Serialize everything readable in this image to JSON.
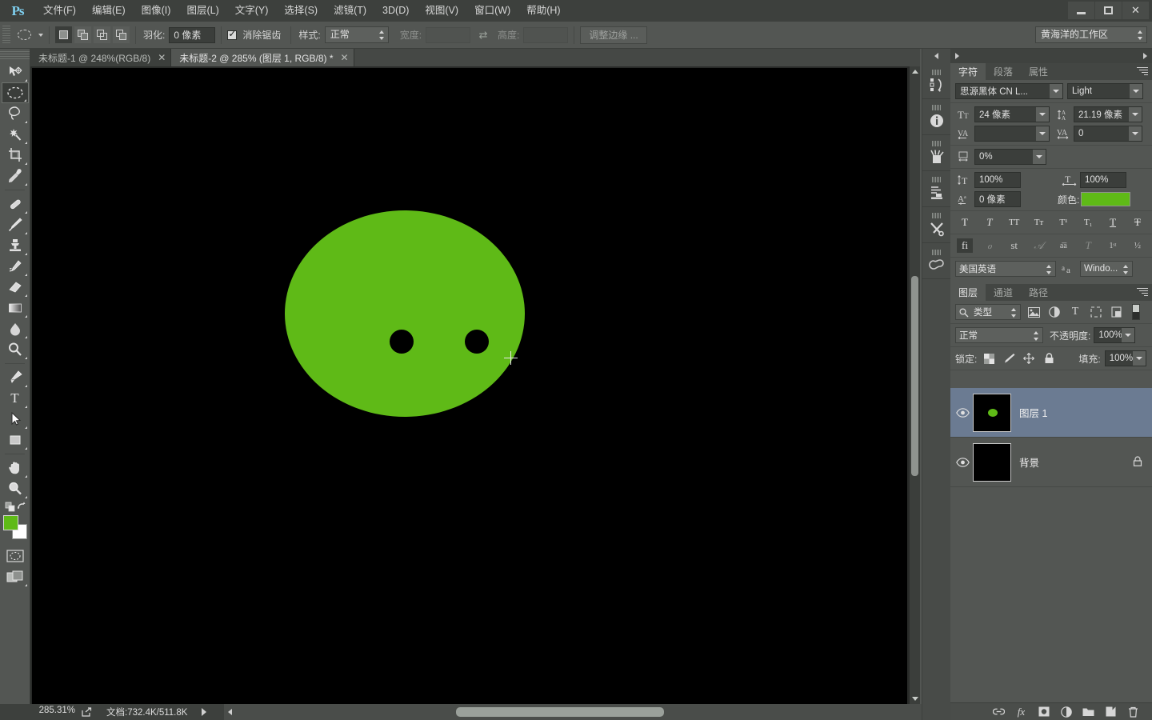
{
  "app": {
    "logo": "Ps",
    "window_controls": {
      "minimize": "minimize-icon",
      "maximize": "maximize-icon",
      "close": "✕"
    }
  },
  "menubar": {
    "items": [
      {
        "label": "文件(F)"
      },
      {
        "label": "编辑(E)"
      },
      {
        "label": "图像(I)"
      },
      {
        "label": "图层(L)"
      },
      {
        "label": "文字(Y)"
      },
      {
        "label": "选择(S)"
      },
      {
        "label": "滤镜(T)"
      },
      {
        "label": "3D(D)"
      },
      {
        "label": "视图(V)"
      },
      {
        "label": "窗口(W)"
      },
      {
        "label": "帮助(H)"
      }
    ]
  },
  "options_bar": {
    "tool": "ellipse-marquee-tool",
    "feather_label": "羽化:",
    "feather_value": "0 像素",
    "antialias_label": "消除锯齿",
    "antialias_checked": true,
    "style_label": "样式:",
    "style_value": "正常",
    "width_label": "宽度:",
    "width_value": "",
    "height_label": "高度:",
    "height_value": "",
    "refine_edge_label": "调整边缘 ...",
    "workspace_value": "黄海洋的工作区"
  },
  "toolbar": {
    "tools": [
      {
        "name": "move-tool",
        "selected": false
      },
      {
        "name": "elliptical-marquee-tool",
        "selected": true
      },
      {
        "name": "lasso-tool",
        "selected": false
      },
      {
        "name": "magic-wand-tool",
        "selected": false
      },
      {
        "name": "crop-tool",
        "selected": false
      },
      {
        "name": "eyedropper-tool",
        "selected": false
      },
      {
        "name": "healing-brush-tool",
        "selected": false
      },
      {
        "name": "brush-tool",
        "selected": false
      },
      {
        "name": "clone-stamp-tool",
        "selected": false
      },
      {
        "name": "history-brush-tool",
        "selected": false
      },
      {
        "name": "eraser-tool",
        "selected": false
      },
      {
        "name": "gradient-tool",
        "selected": false
      },
      {
        "name": "blur-tool",
        "selected": false
      },
      {
        "name": "dodge-tool",
        "selected": false
      },
      {
        "name": "pen-tool",
        "selected": false
      },
      {
        "name": "horizontal-type-tool",
        "selected": false
      },
      {
        "name": "path-selection-tool",
        "selected": false
      },
      {
        "name": "rectangle-tool",
        "selected": false
      },
      {
        "name": "hand-tool",
        "selected": false
      },
      {
        "name": "zoom-tool",
        "selected": false
      }
    ],
    "foreground_color": "#5fba17",
    "background_color": "#ffffff"
  },
  "document_tabs": [
    {
      "title": "未标题-1 @ 248%(RGB/8)",
      "active": false,
      "close": "✕"
    },
    {
      "title": "未标题-2 @ 285% (图层 1, RGB/8) *",
      "active": true,
      "close": "✕"
    }
  ],
  "canvas": {
    "background_color": "#000000",
    "shape_color": "#5fba17",
    "eye_color": "#000000",
    "cursor": "crosshair-cursor"
  },
  "status_bar": {
    "zoom": "285.31%",
    "doc_label": "文档:732.4K/511.8K"
  },
  "rail": {
    "buttons": [
      {
        "name": "history-panel-icon"
      },
      {
        "name": "info-panel-icon"
      },
      {
        "name": "brush-presets-icon"
      },
      {
        "name": "adjustments-icon"
      },
      {
        "name": "tools-preferences-icon"
      },
      {
        "name": "creative-cloud-icon"
      }
    ]
  },
  "character_panel": {
    "tabs": [
      {
        "label": "字符",
        "active": true
      },
      {
        "label": "段落",
        "active": false
      },
      {
        "label": "属性",
        "active": false
      }
    ],
    "font_family": "思源黑体 CN L...",
    "font_style": "Light",
    "font_size_icon": "font-size-icon",
    "font_size": "24 像素",
    "leading_icon": "leading-icon",
    "leading": "21.19 像素",
    "kerning_icon": "kerning-icon",
    "kerning": "",
    "tracking_icon": "tracking-icon",
    "tracking": "0",
    "baseline_scale_icon": "vertical-scale-icon",
    "scale_percent": "0%",
    "vertical_scale": "100%",
    "horizontal_scale": "100%",
    "baseline_shift": "0 像素",
    "color_label": "颜色:",
    "color_value": "#5fba17",
    "style_buttons": [
      "T",
      "T",
      "TT",
      "Tr",
      "T¹",
      "T₁",
      "T",
      "T"
    ],
    "opentype_buttons": [
      "fi",
      "ℴ",
      "st",
      "𝒜",
      "aa",
      "T",
      "1st",
      "½"
    ],
    "language": "美国英语",
    "antialias_icon": "aa-icon",
    "antialias_method": "Windo..."
  },
  "layers_panel": {
    "tabs": [
      {
        "label": "图层",
        "active": true
      },
      {
        "label": "通道",
        "active": false
      },
      {
        "label": "路径",
        "active": false
      }
    ],
    "filter_label": "类型",
    "filter_icons": [
      "pixel-filter-icon",
      "adjustment-filter-icon",
      "type-filter-icon",
      "shape-filter-icon",
      "smartobject-filter-icon"
    ],
    "blend_mode": "正常",
    "opacity_label": "不透明度:",
    "opacity_value": "100%",
    "lock_label": "锁定:",
    "lock_icons": [
      "lock-transparent-icon",
      "lock-image-icon",
      "lock-position-icon",
      "lock-all-icon"
    ],
    "fill_label": "填充:",
    "fill_value": "100%",
    "layers": [
      {
        "name": "图层 1",
        "visible": true,
        "selected": true,
        "locked": false,
        "thumb": "transparent-green-dot"
      },
      {
        "name": "背景",
        "visible": true,
        "selected": false,
        "locked": true,
        "thumb": "black"
      }
    ],
    "bottom_icons": [
      {
        "name": "link-layers-icon",
        "glyph": "🔗"
      },
      {
        "name": "layer-style-icon",
        "glyph": "fx"
      },
      {
        "name": "layer-mask-icon",
        "glyph": "◉"
      },
      {
        "name": "adjustment-layer-icon",
        "glyph": "◐"
      },
      {
        "name": "new-group-icon",
        "glyph": "▭"
      },
      {
        "name": "new-layer-icon",
        "glyph": "▣"
      },
      {
        "name": "delete-layer-icon",
        "glyph": "🗑"
      }
    ]
  }
}
